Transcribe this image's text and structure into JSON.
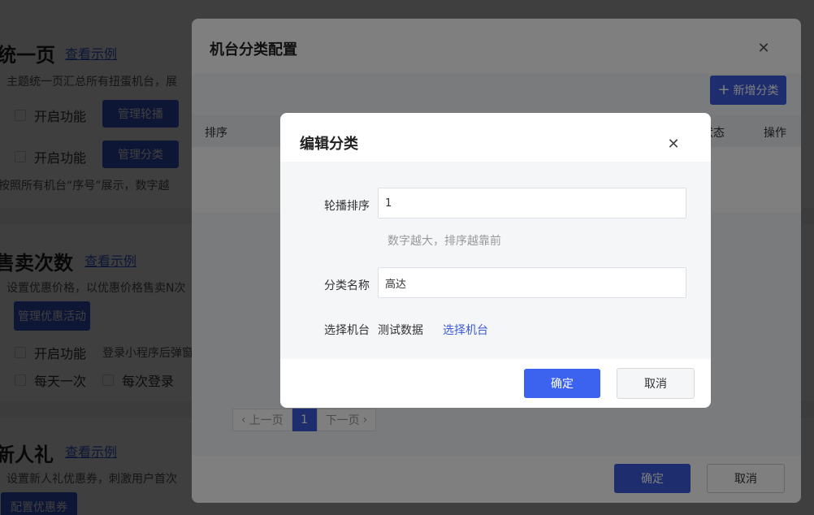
{
  "background": {
    "sections": [
      {
        "title": "统一页",
        "link": "查看示例",
        "desc": "主题统一页汇总所有扭蛋机台，展",
        "rows": [
          {
            "check_label": "开启功能",
            "button": "管理轮播"
          },
          {
            "check_label": "开启功能",
            "button": "管理分类"
          }
        ],
        "note": "按照所有机台“序号”展示，数字越"
      },
      {
        "title": "售卖次数",
        "link": "查看示例",
        "desc": "设置优惠价格，以优惠价格售卖N次",
        "button": "管理优惠活动",
        "row1": {
          "check_label": "开启功能",
          "extra": "登录小程序后弹窗"
        },
        "row2": {
          "opt1": "每天一次",
          "opt2": "每次登录"
        }
      },
      {
        "title": "新人礼",
        "link": "查看示例",
        "desc": "设置新人礼优惠券，刺激用户首次",
        "button": "配置优惠券"
      }
    ]
  },
  "config_dialog": {
    "title": "机台分类配置",
    "add_button": "新增分类",
    "columns": [
      "排序",
      "展示状态",
      "操作"
    ],
    "pager": {
      "prev": "上一页",
      "current": "1",
      "next": "下一页"
    },
    "ok": "确定",
    "cancel": "取消"
  },
  "edit_dialog": {
    "title": "编辑分类",
    "sort_label": "轮播排序",
    "sort_value": "1",
    "sort_hint": "数字越大，排序越靠前",
    "name_label": "分类名称",
    "name_value": "高达",
    "machine_label": "选择机台",
    "machine_value": "测试数据",
    "machine_link": "选择机台",
    "ok": "确定",
    "cancel": "取消"
  },
  "colors": {
    "primary": "#3b5bdb",
    "overlay": "rgba(0,0,0,0.5)"
  }
}
